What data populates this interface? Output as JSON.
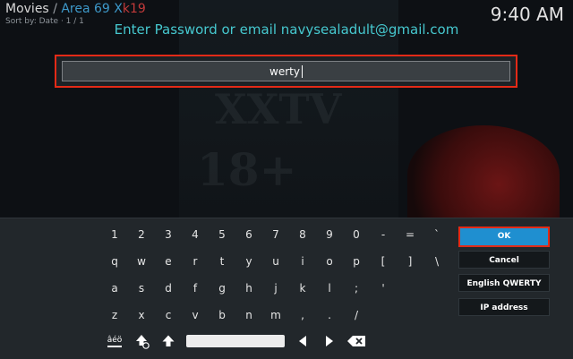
{
  "header": {
    "title_main": "Movies",
    "separator": "/",
    "title_area": "Area 69 X",
    "title_k19": "k19",
    "sort_info": "Sort by: Date  ·  1 / 1",
    "time": "9:40 AM"
  },
  "dialog": {
    "heading": "Enter Password or email navysealadult@gmail.com",
    "input_value": "werty"
  },
  "keyboard": {
    "rows": [
      [
        "1",
        "2",
        "3",
        "4",
        "5",
        "6",
        "7",
        "8",
        "9",
        "0",
        "-",
        "=",
        "`"
      ],
      [
        "q",
        "w",
        "e",
        "r",
        "t",
        "y",
        "u",
        "i",
        "o",
        "p",
        "[",
        "]",
        "\\"
      ],
      [
        "a",
        "s",
        "d",
        "f",
        "g",
        "h",
        "j",
        "k",
        "l",
        ";",
        "'"
      ],
      [
        "z",
        "x",
        "c",
        "v",
        "b",
        "n",
        "m",
        ",",
        ".",
        "/"
      ]
    ],
    "ok_label": "OK",
    "cancel_label": "Cancel",
    "layout_label": "English QWERTY",
    "ip_label": "IP address",
    "accents_label": "âéö"
  },
  "icons": {
    "bottom_row": [
      "accents-icon",
      "shift-lock-icon",
      "shift-icon",
      "space-bar",
      "left-arrow-icon",
      "right-arrow-icon",
      "backspace-icon"
    ]
  },
  "colors": {
    "accent": "#1f8fd0",
    "focus_border": "#e32a17",
    "heading": "#46c8cf"
  }
}
